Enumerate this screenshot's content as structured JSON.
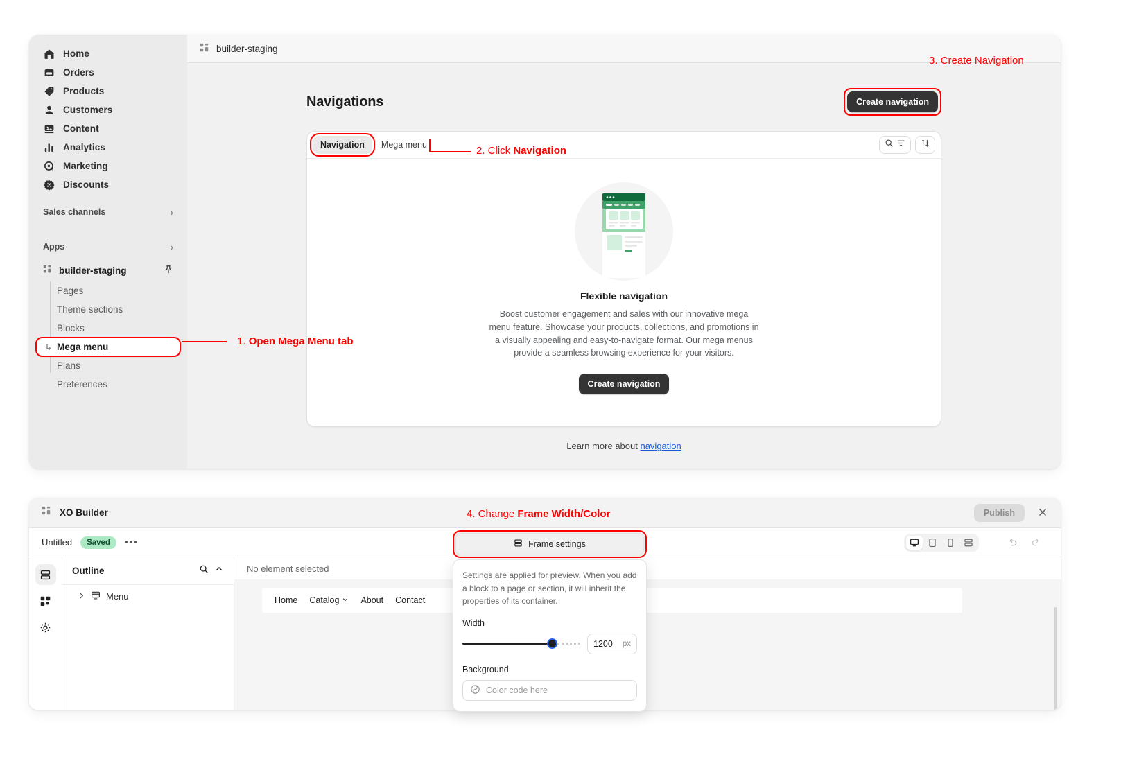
{
  "admin": {
    "sidebar": {
      "primary": [
        {
          "label": "Home",
          "icon": "home-icon"
        },
        {
          "label": "Orders",
          "icon": "orders-icon"
        },
        {
          "label": "Products",
          "icon": "products-icon"
        },
        {
          "label": "Customers",
          "icon": "customers-icon"
        },
        {
          "label": "Content",
          "icon": "content-icon"
        },
        {
          "label": "Analytics",
          "icon": "analytics-icon"
        },
        {
          "label": "Marketing",
          "icon": "marketing-icon"
        },
        {
          "label": "Discounts",
          "icon": "discounts-icon"
        }
      ],
      "sales_channels_label": "Sales channels",
      "apps_label": "Apps",
      "app_name": "builder-staging",
      "app_subitems": [
        {
          "label": "Pages",
          "active": false
        },
        {
          "label": "Theme sections",
          "active": false
        },
        {
          "label": "Blocks",
          "active": false
        },
        {
          "label": "Mega menu",
          "active": true
        },
        {
          "label": "Plans",
          "active": false
        },
        {
          "label": "Preferences",
          "active": false
        }
      ]
    },
    "topbar": {
      "breadcrumb": "builder-staging"
    },
    "page": {
      "title": "Navigations",
      "create_button": "Create navigation",
      "tabs": [
        {
          "label": "Navigation",
          "active": true
        },
        {
          "label": "Mega menu",
          "active": false
        }
      ],
      "empty": {
        "title": "Flexible navigation",
        "description": "Boost customer engagement and sales with our innovative mega menu feature. Showcase your products, collections, and promotions in a visually appealing and easy-to-navigate format. Our mega menus provide a seamless browsing experience for your visitors.",
        "cta": "Create navigation"
      },
      "learn_more_prefix": "Learn more about ",
      "learn_more_link": "navigation"
    }
  },
  "annotations": {
    "step1": {
      "num": "1. ",
      "text": "Open Mega Menu tab"
    },
    "step2": {
      "num": "2. Click ",
      "bold": "Navigation"
    },
    "step3": {
      "text": "3. Create Navigation"
    },
    "step4": {
      "num": "4. Change ",
      "bold": "Frame Width/Color"
    }
  },
  "builder": {
    "title": "XO Builder",
    "publish_label": "Publish",
    "doc_name": "Untitled",
    "saved_badge": "Saved",
    "more_dots": "•••",
    "outline": {
      "title": "Outline",
      "items": [
        {
          "label": "Menu"
        }
      ]
    },
    "canvas": {
      "no_selection": "No element selected",
      "menu_items": [
        "Home",
        "Catalog",
        "About",
        "Contact"
      ]
    },
    "frame_settings": {
      "button_label": "Frame settings",
      "description": "Settings are applied for preview. When you add a block to a page or section, it will inherit the properties of its container.",
      "width_label": "Width",
      "width_value": "1200",
      "width_unit": "px",
      "background_label": "Background",
      "color_placeholder": "Color code here"
    }
  },
  "colors": {
    "annotation_red": "#ff0000",
    "link_blue": "#1a5cd8",
    "saved_green": "#aee9c6",
    "dark_button": "#343434"
  }
}
